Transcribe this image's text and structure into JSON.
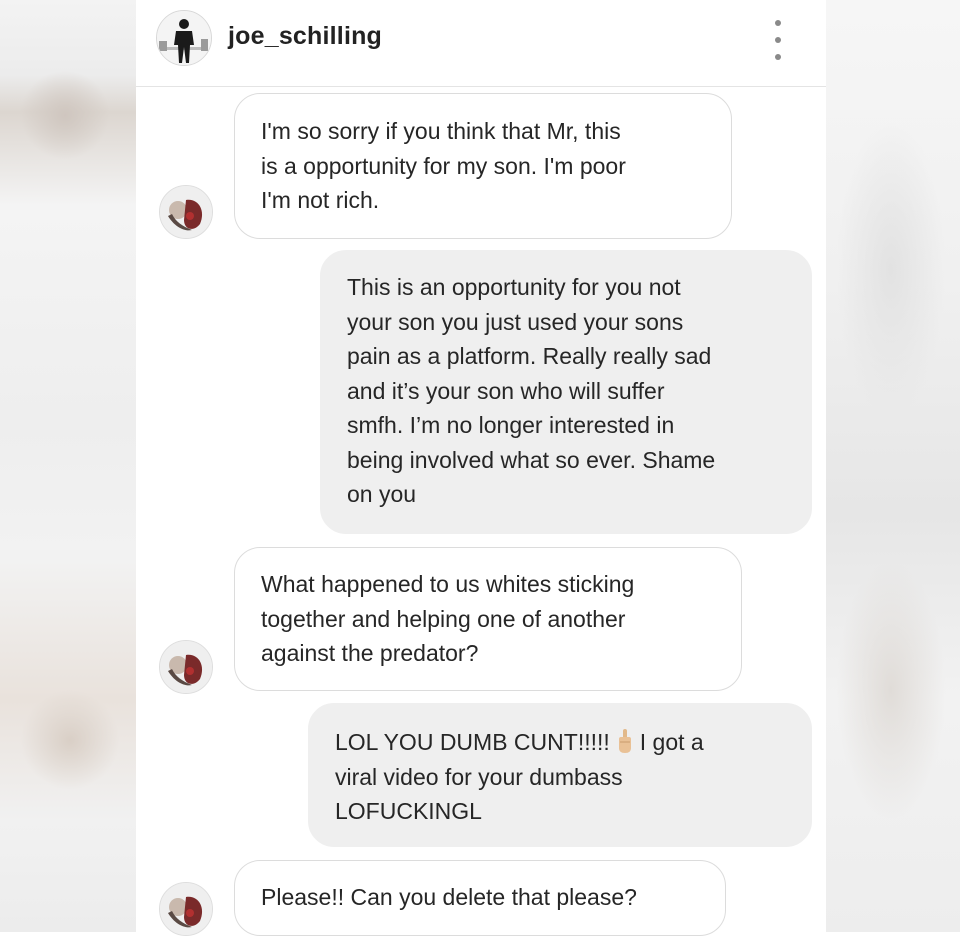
{
  "header": {
    "username": "joe_schilling",
    "avatar_icon": "profile-photo-icon",
    "menu_icon": "more-vertical-icon"
  },
  "messages": [
    {
      "direction": "incoming",
      "lines": [
        "I'm so sorry if you think that Mr, this",
        "is a opportunity for my son. I'm poor",
        "I'm not rich."
      ]
    },
    {
      "direction": "outgoing",
      "lines": [
        "This is an opportunity for you not",
        "your son you just used your sons",
        "pain as a platform. Really really sad",
        "and it’s your son who will suffer",
        "smfh.  I’m no longer interested in",
        "being involved what so ever. Shame",
        "on you"
      ]
    },
    {
      "direction": "incoming",
      "lines": [
        "What happened to us whites sticking",
        "together and helping one of another",
        "against the predator?"
      ]
    },
    {
      "direction": "outgoing",
      "lines": [
        "LOL YOU DUMB CUNT!!!!!",
        "I got a",
        "viral video for your dumbass",
        "LOFUCKINGL"
      ],
      "emoji_icon": "middle-finger-emoji-icon"
    },
    {
      "direction": "incoming",
      "lines": [
        "Please!! Can you delete that please?"
      ]
    }
  ],
  "colors": {
    "incoming_bg": "#ffffff",
    "outgoing_bg": "#efefef",
    "text": "#262626"
  }
}
